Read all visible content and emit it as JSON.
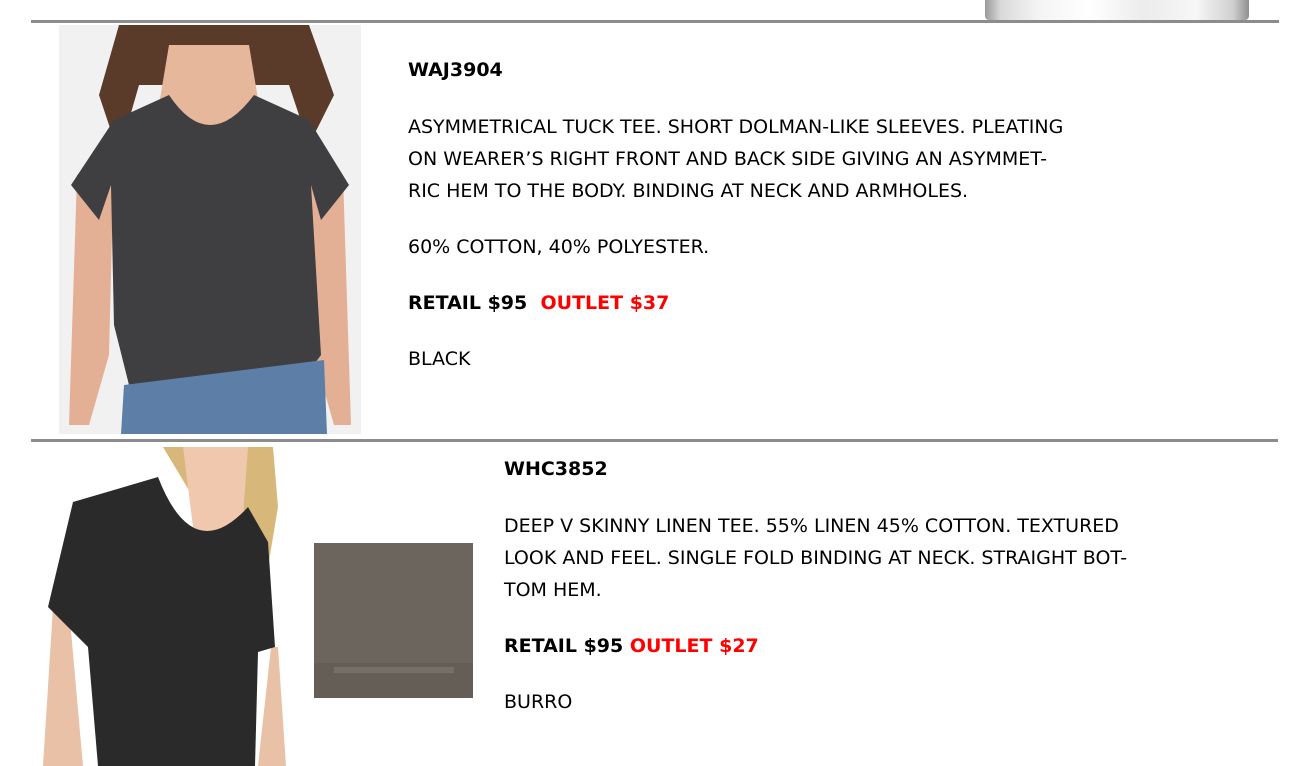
{
  "products": [
    {
      "sku": "WAJ3904",
      "description_lines": [
        "ASYMMETRICAL TUCK TEE. SHORT DOLMAN-LIKE SLEEVES. PLEATING",
        "ON WEARER’S RIGHT FRONT AND BACK SIDE GIVING AN ASYMMET-",
        "RIC HEM TO THE BODY. BINDING AT NECK AND ARMHOLES."
      ],
      "fabric": "60% COTTON, 40% POLYESTER.",
      "retail": "RETAIL $95",
      "outlet": "OUTLET $37",
      "color": "BLACK",
      "photo_icon": "product-photo",
      "shirt_color": "#3f3f41"
    },
    {
      "sku": "WHC3852",
      "description_lines": [
        "DEEP V SKINNY LINEN TEE. 55% LINEN 45% COTTON. TEXTURED",
        "LOOK AND FEEL. SINGLE FOLD BINDING AT NECK. STRAIGHT BOT-",
        "TOM HEM."
      ],
      "retail": "RETAIL $95",
      "outlet": "OUTLET $27",
      "color": "BURRO",
      "photo_icon": "product-photo",
      "shirt_color": "#2a2a2a",
      "swatch_color": "#6b655d"
    }
  ],
  "accent_color": "#ff0000"
}
